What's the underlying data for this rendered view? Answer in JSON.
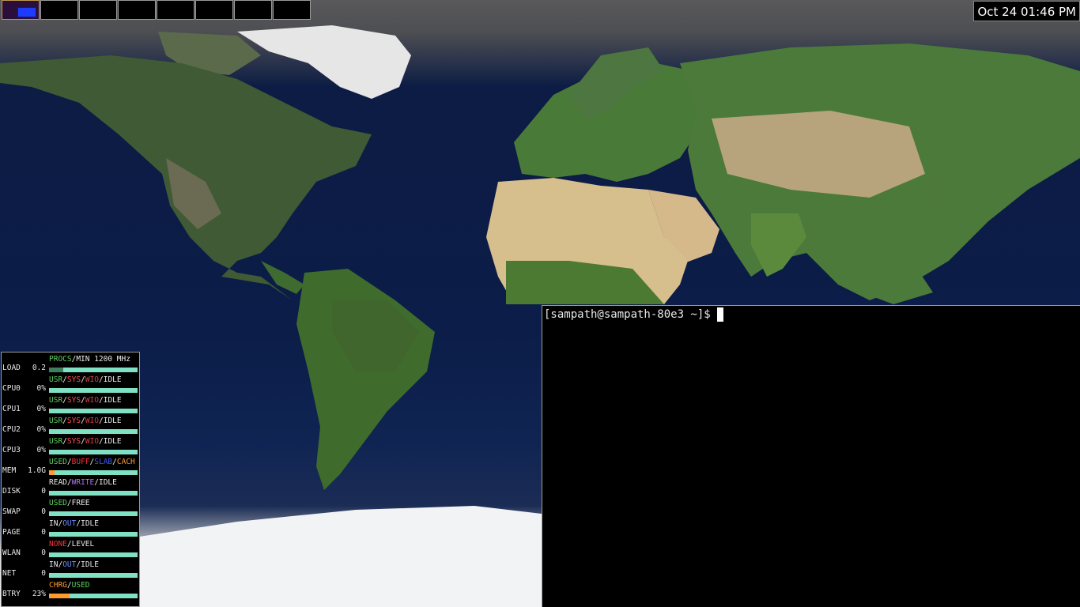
{
  "clock": {
    "text": "Oct 24 01:46 PM"
  },
  "pager": {
    "workspaces": [
      1,
      2,
      3,
      4,
      5,
      6,
      7,
      8
    ],
    "active": 1
  },
  "terminal": {
    "prompt": "[sampath@sampath-80e3 ~]$"
  },
  "monitor": {
    "rows": [
      {
        "name": "LOAD",
        "value": "0.2",
        "parts": [
          "PROCS",
          "/MIN 1200 MHz"
        ],
        "fill": 0.16,
        "fill_color": "#3f7f5f"
      },
      {
        "name": "CPU0",
        "value": "0%",
        "parts": [
          "USR",
          "/",
          "SYS",
          "/",
          "WIO",
          "/",
          "IDLE"
        ],
        "fill": 0.0,
        "fill_color": "#5fcf5f"
      },
      {
        "name": "CPU1",
        "value": "0%",
        "parts": [
          "USR",
          "/",
          "SYS",
          "/",
          "WIO",
          "/",
          "IDLE"
        ],
        "fill": 0.0,
        "fill_color": "#5fcf5f"
      },
      {
        "name": "CPU2",
        "value": "0%",
        "parts": [
          "USR",
          "/",
          "SYS",
          "/",
          "WIO",
          "/",
          "IDLE"
        ],
        "fill": 0.0,
        "fill_color": "#5fcf5f"
      },
      {
        "name": "CPU3",
        "value": "0%",
        "parts": [
          "USR",
          "/",
          "SYS",
          "/",
          "WIO",
          "/",
          "IDLE"
        ],
        "fill": 0.0,
        "fill_color": "#5fcf5f"
      },
      {
        "name": "MEM",
        "value": "1.0G",
        "parts": [
          "USED",
          "/",
          "BUFF",
          "/",
          "SLAB",
          "/",
          "CACH"
        ],
        "fill": 0.06,
        "fill_color": "#ff9a30"
      },
      {
        "name": "DISK",
        "value": "0",
        "parts": [
          "READ",
          "/",
          "WRITE",
          "/",
          "IDLE"
        ],
        "fill": 0.0,
        "fill_color": "#5fcf5f"
      },
      {
        "name": "SWAP",
        "value": "0",
        "parts": [
          "USED",
          "/",
          "FREE"
        ],
        "fill": 0.0,
        "fill_color": "#5fcf5f"
      },
      {
        "name": "PAGE",
        "value": "0",
        "parts": [
          "IN",
          "/",
          "OUT",
          "/",
          "IDLE"
        ],
        "fill": 0.0,
        "fill_color": "#5fcf5f"
      },
      {
        "name": "WLAN",
        "value": "0",
        "parts": [
          "NONE",
          "/",
          "LEVEL"
        ],
        "fill": 0.0,
        "fill_color": "#ff3030"
      },
      {
        "name": "NET",
        "value": "0",
        "parts": [
          "IN",
          "/",
          "OUT",
          "/",
          "IDLE"
        ],
        "fill": 0.0,
        "fill_color": "#5fcf5f"
      },
      {
        "name": "BTRY",
        "value": "23%",
        "parts": [
          "CHRG",
          "/",
          "USED"
        ],
        "fill": 0.23,
        "fill_color": "#ff9a30"
      }
    ]
  },
  "colors": {
    "ocean": "#0b1d48",
    "terminal_bg": "#000000",
    "bar_idle": "#7fe0c4"
  }
}
